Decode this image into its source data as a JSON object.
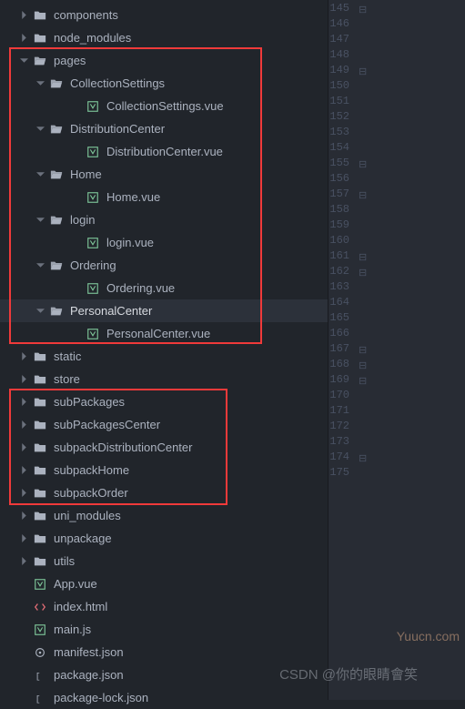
{
  "tree": [
    {
      "indent": 1,
      "arrow": "right",
      "icon": "folder",
      "name": "tree-item-components",
      "label": "components"
    },
    {
      "indent": 1,
      "arrow": "right",
      "icon": "folder",
      "name": "tree-item-node-modules",
      "label": "node_modules"
    },
    {
      "indent": 1,
      "arrow": "down",
      "icon": "folder-open",
      "name": "tree-item-pages",
      "label": "pages"
    },
    {
      "indent": 2,
      "arrow": "down",
      "icon": "folder-open",
      "name": "tree-item-collectionsettings",
      "label": "CollectionSettings"
    },
    {
      "indent": 4,
      "arrow": "none",
      "icon": "vue",
      "name": "tree-file-collectionsettings-vue",
      "label": "CollectionSettings.vue"
    },
    {
      "indent": 2,
      "arrow": "down",
      "icon": "folder-open",
      "name": "tree-item-distributioncenter",
      "label": "DistributionCenter"
    },
    {
      "indent": 4,
      "arrow": "none",
      "icon": "vue",
      "name": "tree-file-distributioncenter-vue",
      "label": "DistributionCenter.vue"
    },
    {
      "indent": 2,
      "arrow": "down",
      "icon": "folder-open",
      "name": "tree-item-home",
      "label": "Home"
    },
    {
      "indent": 4,
      "arrow": "none",
      "icon": "vue",
      "name": "tree-file-home-vue",
      "label": "Home.vue"
    },
    {
      "indent": 2,
      "arrow": "down",
      "icon": "folder-open",
      "name": "tree-item-login",
      "label": "login"
    },
    {
      "indent": 4,
      "arrow": "none",
      "icon": "vue",
      "name": "tree-file-login-vue",
      "label": "login.vue"
    },
    {
      "indent": 2,
      "arrow": "down",
      "icon": "folder-open",
      "name": "tree-item-ordering",
      "label": "Ordering"
    },
    {
      "indent": 4,
      "arrow": "none",
      "icon": "vue",
      "name": "tree-file-ordering-vue",
      "label": "Ordering.vue"
    },
    {
      "indent": 2,
      "arrow": "down",
      "icon": "folder-open",
      "name": "tree-item-personalcenter",
      "label": "PersonalCenter",
      "selected": true
    },
    {
      "indent": 4,
      "arrow": "none",
      "icon": "vue",
      "name": "tree-file-personalcenter-vue",
      "label": "PersonalCenter.vue"
    },
    {
      "indent": 1,
      "arrow": "right",
      "icon": "folder",
      "name": "tree-item-static",
      "label": "static"
    },
    {
      "indent": 1,
      "arrow": "right",
      "icon": "folder",
      "name": "tree-item-store",
      "label": "store"
    },
    {
      "indent": 1,
      "arrow": "right",
      "icon": "folder",
      "name": "tree-item-subpackages",
      "label": "subPackages"
    },
    {
      "indent": 1,
      "arrow": "right",
      "icon": "folder",
      "name": "tree-item-subpackagescenter",
      "label": "subPackagesCenter"
    },
    {
      "indent": 1,
      "arrow": "right",
      "icon": "folder",
      "name": "tree-item-subpackdistributioncenter",
      "label": "subpackDistributionCenter"
    },
    {
      "indent": 1,
      "arrow": "right",
      "icon": "folder",
      "name": "tree-item-subpackhome",
      "label": "subpackHome"
    },
    {
      "indent": 1,
      "arrow": "right",
      "icon": "folder",
      "name": "tree-item-subpackorder",
      "label": "subpackOrder"
    },
    {
      "indent": 1,
      "arrow": "right",
      "icon": "folder",
      "name": "tree-item-uni-modules",
      "label": "uni_modules"
    },
    {
      "indent": 1,
      "arrow": "right",
      "icon": "folder",
      "name": "tree-item-unpackage",
      "label": "unpackage"
    },
    {
      "indent": 1,
      "arrow": "right",
      "icon": "folder",
      "name": "tree-item-utils",
      "label": "utils"
    },
    {
      "indent": 1,
      "arrow": "none",
      "icon": "vue",
      "name": "tree-file-app-vue",
      "label": "App.vue"
    },
    {
      "indent": 1,
      "arrow": "none",
      "icon": "html",
      "name": "tree-file-index-html",
      "label": "index.html"
    },
    {
      "indent": 1,
      "arrow": "none",
      "icon": "vue",
      "name": "tree-file-main-js",
      "label": "main.js"
    },
    {
      "indent": 1,
      "arrow": "none",
      "icon": "json-alt",
      "name": "tree-file-manifest-json",
      "label": "manifest.json"
    },
    {
      "indent": 1,
      "arrow": "none",
      "icon": "json",
      "name": "tree-file-package-json",
      "label": "package.json"
    },
    {
      "indent": 1,
      "arrow": "none",
      "icon": "json",
      "name": "tree-file-package-lock-json",
      "label": "package-lock.json"
    }
  ],
  "gutter": {
    "start": 145,
    "end": 175,
    "first_partial": "",
    "foldable": [
      145,
      149,
      155,
      157,
      161,
      162,
      167,
      168,
      169,
      174
    ]
  },
  "watermarks": {
    "w1": "Yuucn.com",
    "w2": "CSDN @你的眼睛會笑"
  }
}
